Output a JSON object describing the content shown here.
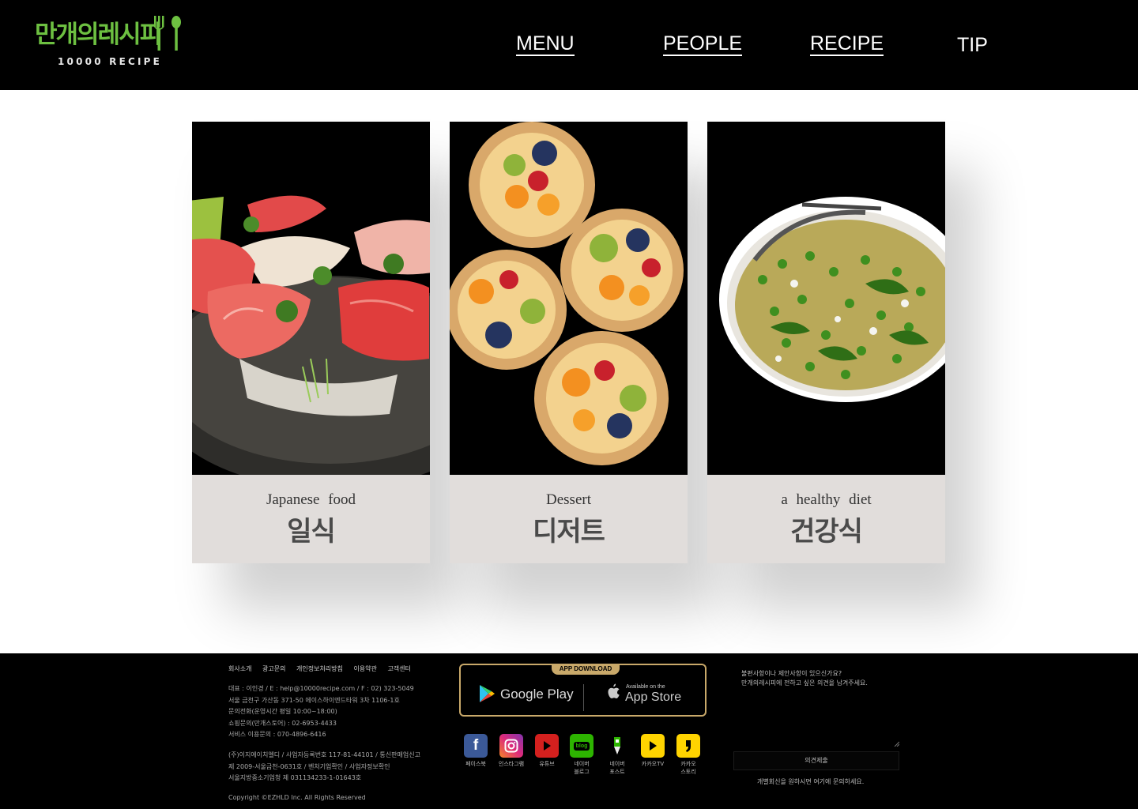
{
  "header": {
    "logo_kr": "만개의레시피",
    "logo_en": "10000 RECIPE",
    "nav": [
      {
        "label": "MENU"
      },
      {
        "label": "PEOPLE"
      },
      {
        "label": "RECIPE"
      },
      {
        "label": "TIP"
      }
    ]
  },
  "cards": [
    {
      "en": "Japanese food",
      "kr": "일식",
      "image": "sashimi platter"
    },
    {
      "en": "Dessert",
      "kr": "디저트",
      "image": "fruit tarts"
    },
    {
      "en": "a healthy diet",
      "kr": "건강식",
      "image": "pasta salad with peas"
    }
  ],
  "footer": {
    "links": [
      "회사소개",
      "광고문의",
      "개인정보처리방침",
      "이용약관",
      "고객센터"
    ],
    "info": [
      "대표 : 이인경 / E : help@10000recipe.com / F : 02) 323-5049",
      "서울 금천구 가산동 371-50 에이스하이엔드타워 3차 1106-1호",
      "문의전화(운영시간 평일 10:00~18:00)",
      "쇼핑문의(만개스토어) : 02-6953-4433",
      "서비스 이용문의 : 070-4896-6416"
    ],
    "info2": [
      "(주)이지에이치엘디 / 사업자등록번호 117-81-44101 / 통신판매업신고",
      "제 2009-서울금천-0631호 / 벤처기업확인 / 사업자정보확인",
      "서울지방중소기업청 제 031134233-1-01643호"
    ],
    "copyright": "Copyright ©EZHLD Inc. All Rights Reserved",
    "app": {
      "tab": "APP DOWNLOAD",
      "google": "Google Play",
      "apple_small": "Available on the",
      "apple_big": "App Store"
    },
    "sns": [
      {
        "label": "페이스북",
        "icon": "facebook-icon",
        "color": "#3b5998"
      },
      {
        "label": "인스타그램",
        "icon": "instagram-icon",
        "color": "#c13584"
      },
      {
        "label": "유튜브",
        "icon": "youtube-icon",
        "color": "#d4201e"
      },
      {
        "label": "네이버\n블로그",
        "icon": "naver-blog-icon",
        "color": "#2db400"
      },
      {
        "label": "네이버\n포스트",
        "icon": "naver-post-icon",
        "color": "#000000"
      },
      {
        "label": "카카오TV",
        "icon": "kakao-tv-icon",
        "color": "#ffd400"
      },
      {
        "label": "카카오\n스토리",
        "icon": "kakao-story-icon",
        "color": "#ffd400"
      }
    ],
    "feedback": {
      "question_1": "불편사항이나 제안사항이 있으신가요?",
      "question_2": "만개의레시피에 전하고 싶은 의견을 남겨주세요.",
      "button": "의견제출",
      "note": "개별회신을 원하시면 여기에 문의하세요."
    },
    "colors": {
      "accent_gold": "#c9a96a",
      "logo_green": "#6dc041"
    }
  }
}
